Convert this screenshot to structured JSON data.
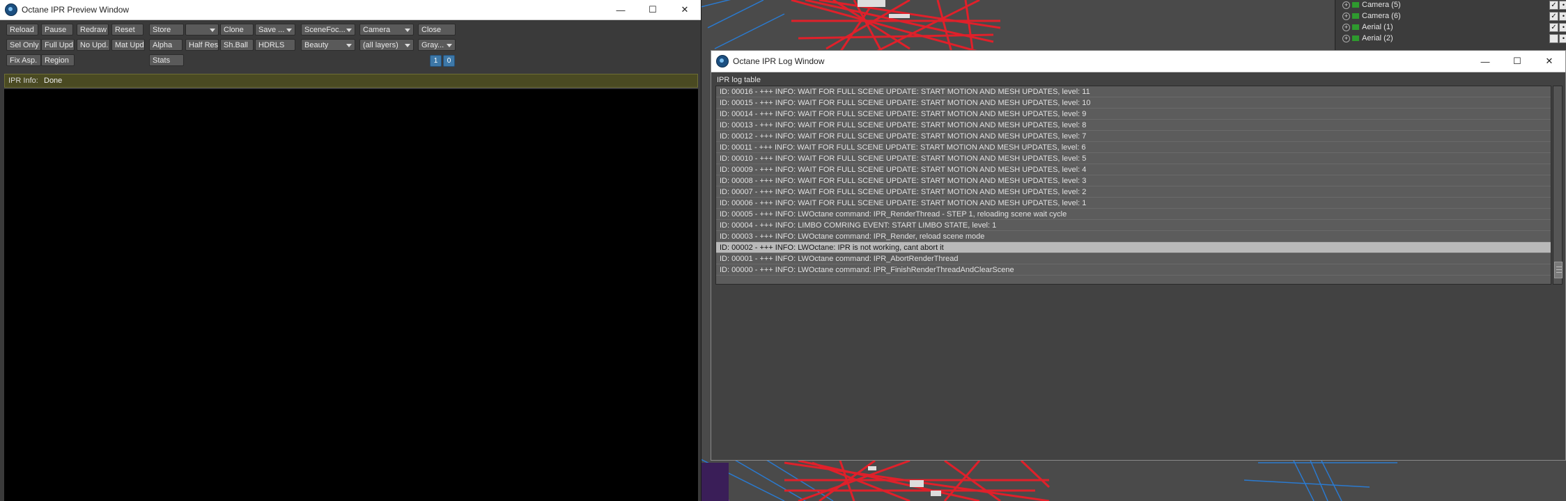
{
  "preview_window": {
    "title": "Octane IPR Preview Window",
    "controls": {
      "minimize": "—",
      "maximize": "☐",
      "close": "✕"
    },
    "toolbar_row1": [
      "Reload",
      "Pause",
      "Redraw",
      "Reset",
      "Store",
      "",
      "Clone",
      "Save ...",
      "SceneFoc...",
      "Camera",
      "Close"
    ],
    "toolbar_row2": [
      "Sel Only",
      "Full Upd.",
      "No Upd.",
      "Mat Upd",
      "Alpha",
      "Half Res",
      "Sh.Ball",
      "HDRLS",
      "Beauty",
      "(all layers)",
      "Gray..."
    ],
    "toolbar_row3": [
      "Fix Asp.",
      "Region",
      "Stats"
    ],
    "page_buttons": [
      "1",
      "0"
    ],
    "ipr_info_label": "IPR Info:",
    "ipr_info_value": "Done"
  },
  "log_window": {
    "title": "Octane IPR Log Window",
    "controls": {
      "minimize": "—",
      "maximize": "☐",
      "close": "✕"
    },
    "caption": "IPR log table",
    "rows": [
      "ID: 00016 -  +++ INFO: WAIT FOR FULL SCENE UPDATE: START MOTION AND MESH UPDATES, level: 11",
      "ID: 00015 -  +++ INFO: WAIT FOR FULL SCENE UPDATE: START MOTION AND MESH UPDATES, level: 10",
      "ID: 00014 -  +++ INFO: WAIT FOR FULL SCENE UPDATE: START MOTION AND MESH UPDATES, level: 9",
      "ID: 00013 -  +++ INFO: WAIT FOR FULL SCENE UPDATE: START MOTION AND MESH UPDATES, level: 8",
      "ID: 00012 -  +++ INFO: WAIT FOR FULL SCENE UPDATE: START MOTION AND MESH UPDATES, level: 7",
      "ID: 00011 -  +++ INFO: WAIT FOR FULL SCENE UPDATE: START MOTION AND MESH UPDATES, level: 6",
      "ID: 00010 -  +++ INFO: WAIT FOR FULL SCENE UPDATE: START MOTION AND MESH UPDATES, level: 5",
      "ID: 00009 -  +++ INFO: WAIT FOR FULL SCENE UPDATE: START MOTION AND MESH UPDATES, level: 4",
      "ID: 00008 -  +++ INFO: WAIT FOR FULL SCENE UPDATE: START MOTION AND MESH UPDATES, level: 3",
      "ID: 00007 -  +++ INFO: WAIT FOR FULL SCENE UPDATE: START MOTION AND MESH UPDATES, level: 2",
      "ID: 00006 -  +++ INFO: WAIT FOR FULL SCENE UPDATE: START MOTION AND MESH UPDATES, level: 1",
      "ID: 00005 -  +++ INFO: LWOctane command: IPR_RenderThread - STEP 1, reloading scene wait cycle",
      "ID: 00004 -  +++ INFO: LIMBO COMRING EVENT: START LIMBO STATE, level: 1",
      "ID: 00003 -  +++ INFO: LWOctane command: IPR_Render, reload scene mode",
      "ID: 00002 -  +++ INFO: LWOctane: IPR is not working, cant abort it",
      "ID: 00001 -  +++ INFO: LWOctane command: IPR_AbortRenderThread",
      "ID: 00000 -  +++ INFO: LWOctane command: IPR_FinishRenderThreadAndClearScene"
    ],
    "highlighted_row": 14
  },
  "scene_list": [
    {
      "label": "Camera (5)",
      "check": "✓",
      "dot": "•"
    },
    {
      "label": "Camera (6)",
      "check": "✓",
      "dot": "•"
    },
    {
      "label": "Aerial (1)",
      "check": "✓",
      "dot": "•"
    },
    {
      "label": "Aerial (2)",
      "check": "",
      "dot": "•"
    }
  ],
  "colors": {
    "wire_red": "#e0202a",
    "wire_blue": "#2a7ad0",
    "wire_purple": "#8a2ab8",
    "highlight_row": "#b9b9b9",
    "ipr_info_bg": "#4a4a22"
  }
}
